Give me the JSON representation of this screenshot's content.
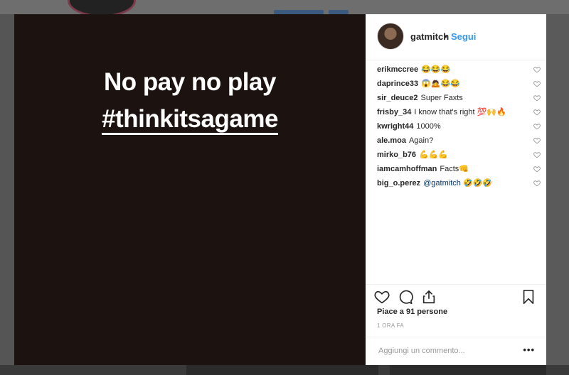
{
  "story": {
    "line1": "No pay no play",
    "line2": "#thinkitsagame"
  },
  "header": {
    "username": "gatmitch",
    "separator": "•",
    "follow_label": "Segui"
  },
  "comments": [
    {
      "user": "erikmccree",
      "text": "😂😂😂"
    },
    {
      "user": "daprince33",
      "text": "😱🙇😂😂"
    },
    {
      "user": "sir_deuce2",
      "text": "Super Faxts"
    },
    {
      "user": "frisby_34",
      "text": "I know that's right 💯🙌🔥"
    },
    {
      "user": "kwright44",
      "text": "1000%"
    },
    {
      "user": "ale.moa",
      "text": "Again?"
    },
    {
      "user": "mirko_b76",
      "text": "💪💪💪"
    },
    {
      "user": "iamcamhoffman",
      "text": "Facts👊"
    },
    {
      "user": "big_o.perez",
      "mention": "@gatmitch",
      "text": "🤣🤣🤣"
    }
  ],
  "likes": "Piace a 91 persone",
  "time": "1 ORA FA",
  "add_comment": {
    "placeholder": "Aggiungi un commento..."
  },
  "more_label": "•••",
  "icons": {
    "like": "heart-icon",
    "comment": "comment-icon",
    "share": "share-icon",
    "save": "bookmark-icon"
  },
  "colors": {
    "accent": "#3897f0",
    "media_bg": "#1c1311",
    "text": "#262626"
  }
}
